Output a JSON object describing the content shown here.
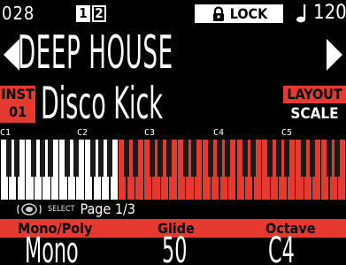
{
  "status": {
    "pattern_number": "028",
    "parts": [
      "1",
      "2"
    ],
    "lock_label": "LOCK",
    "tempo": "120.0"
  },
  "project": {
    "name": "DEEP HOUSE"
  },
  "instrument": {
    "badge_line1": "INST",
    "badge_line2": "01",
    "name": "Disco Kick",
    "layout_badge": "LAYOUT",
    "layout_value": "SCALE"
  },
  "keyboard": {
    "octave_labels": [
      "C1",
      "C2",
      "C3",
      "C4",
      "C5"
    ],
    "highlight_start_key": 14,
    "highlight_end_key": 40,
    "highlight_color": "#e63a30",
    "white_key_color": "#ffffff",
    "black_key_color": "#1a1a1a"
  },
  "params": {
    "select_label": "SELECT",
    "page_label": "Page 1/3",
    "columns": [
      {
        "name": "Mono/Poly",
        "value": "Mono"
      },
      {
        "name": "Glide",
        "value": "50"
      },
      {
        "name": "Octave",
        "value": "C4"
      }
    ]
  },
  "colors": {
    "accent": "#e63a30",
    "background": "#000000",
    "text": "#ffffff"
  },
  "icons": {
    "lock": "padlock-icon",
    "tempo": "quarter-note-icon",
    "prev": "triangle-left-icon",
    "next": "triangle-right-icon",
    "select": "knob-icon"
  }
}
